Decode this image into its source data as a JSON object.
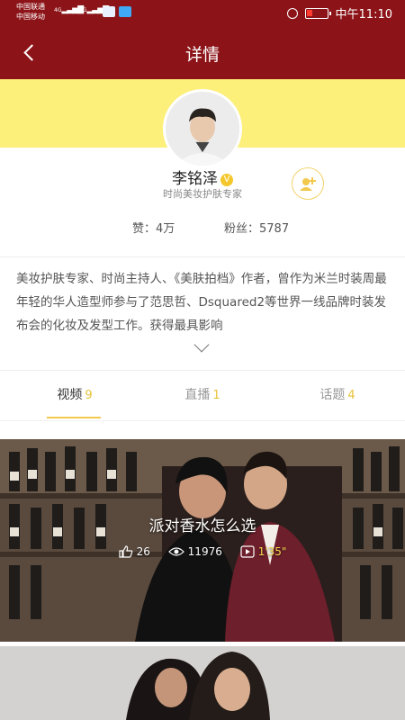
{
  "status_bar": {
    "carrier_1": "中国联通",
    "carrier_2": "中国移动",
    "network_1": "4G",
    "network_2": "2G",
    "time": "中午11:10",
    "icons": [
      "signal-icon",
      "shield-app-icon",
      "gallery-app-icon",
      "alarm-icon",
      "battery-icon"
    ],
    "battery_level": 0.2
  },
  "nav": {
    "title": "详情"
  },
  "profile": {
    "name": "李铭泽",
    "verified_badge": "V",
    "subtitle": "时尚美妆护肤专家",
    "likes_label": "赞：",
    "likes_value": "4万",
    "fans_label": "粉丝：",
    "fans_value": "5787",
    "bio": "美妆护肤专家、时尚主持人、《美肤拍档》作者，曾作为米兰时装周最年轻的华人造型师参与了范思哲、Dsquared2等世界一线品牌时装发布会的化妆及发型工作。获得最具影响"
  },
  "tabs": [
    {
      "label": "视频",
      "count": "9",
      "active": true
    },
    {
      "label": "直播",
      "count": "1",
      "active": false
    },
    {
      "label": "话题",
      "count": "4",
      "active": false
    }
  ],
  "videos": [
    {
      "title": "派对香水怎么选",
      "likes": "26",
      "views": "11976",
      "duration": "1'35\""
    }
  ],
  "colors": {
    "header": "#8c1418",
    "band": "#fcef7a",
    "accent": "#f2c94c",
    "count": "#e8c23a"
  }
}
